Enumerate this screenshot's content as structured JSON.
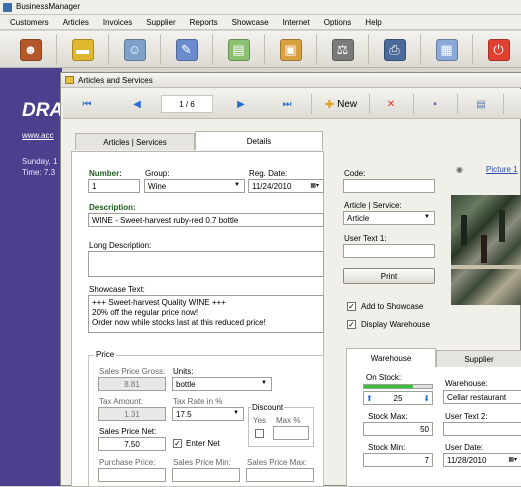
{
  "app": {
    "title": "BusinessManager"
  },
  "menu": [
    "Customers",
    "Articles",
    "Invoices",
    "Supplier",
    "Reports",
    "Showcase",
    "Internet",
    "Options",
    "Help"
  ],
  "toolbar": [
    {
      "icon": "users-icon",
      "color": "#b4572a",
      "glyph": "☻"
    },
    {
      "icon": "folder-icon",
      "color": "#e0b830",
      "glyph": "▬"
    },
    {
      "icon": "group-icon",
      "color": "#7fa0c8",
      "glyph": "☺"
    },
    {
      "icon": "pen-icon",
      "color": "#6a8ccc",
      "glyph": "✎"
    },
    {
      "icon": "chart-icon",
      "color": "#8bc070",
      "glyph": "▤"
    },
    {
      "icon": "picture-icon",
      "color": "#d8a040",
      "glyph": "▣"
    },
    {
      "icon": "scales-icon",
      "color": "#7a7a7a",
      "glyph": "⚖"
    },
    {
      "icon": "printer-icon",
      "color": "#4a6a9a",
      "glyph": "⎙"
    },
    {
      "icon": "calculator-icon",
      "color": "#8aa8d8",
      "glyph": "▦"
    },
    {
      "icon": "power-icon",
      "color": "#e04030",
      "glyph": "⏻"
    }
  ],
  "background": {
    "brand": "DRA",
    "link": "www.acc",
    "date": "Sunday, 1",
    "time": "Time: 7.3"
  },
  "window": {
    "title": "Articles and Services",
    "counter": "1 / 6",
    "new_label": "New",
    "tabs": [
      "Articles | Services",
      "Details"
    ]
  },
  "form": {
    "number_label": "Number:",
    "number": "1",
    "group_label": "Group:",
    "group": "Wine",
    "reg_date_label": "Reg. Date:",
    "reg_date": "11/24/2010",
    "code_label": "Code:",
    "code": "",
    "description_label": "Description:",
    "description": "WINE - Sweet-harvest ruby-red 0.7 bottle",
    "article_service_label": "Article | Service:",
    "article_service": "Article",
    "user_text1_label": "User Text 1:",
    "user_text1": "",
    "long_description_label": "Long Description:",
    "long_description": "",
    "print_label": "Print",
    "showcase_text_label": "Showcase Text:",
    "showcase_lines": [
      "+++ Sweet-harvest Quality WINE +++",
      "20% off the regular price now!",
      "Order now while stocks last at this reduced price!"
    ],
    "add_showcase_label": "Add to Showcase",
    "add_showcase": true,
    "display_warehouse_label": "Display Warehouse",
    "display_warehouse": true,
    "picture_link": "Picture 1"
  },
  "price": {
    "group_label": "Price",
    "gross_label": "Sales Price Gross:",
    "gross": "8.81",
    "units_label": "Units:",
    "units": "bottle",
    "tax_amount_label": "Tax Amount:",
    "tax_amount": "1.31",
    "tax_rate_label": "Tax Rate in %",
    "tax_rate": "17.5",
    "discount_label": "Discount",
    "yes_label": "Yes",
    "max_label": "Max %",
    "max": "",
    "net_label": "Sales Price Net:",
    "net": "7.50",
    "enter_net_label": "Enter Net",
    "enter_net": true,
    "purchase_label": "Purchase Price:",
    "min_label": "Sales Price Min:",
    "max_price_label": "Sales Price Max:"
  },
  "warehouse": {
    "tabs": [
      "Warehouse",
      "Supplier"
    ],
    "on_stock_label": "On Stock:",
    "on_stock": "25",
    "stock_fill": 0.72,
    "warehouse_label": "Warehouse:",
    "warehouse": "Cellar restaurant",
    "stock_max_label": "Stock Max:",
    "stock_max": "50",
    "user_text2_label": "User Text 2:",
    "user_text2": "",
    "stock_min_label": "Stock Min:",
    "stock_min": "7",
    "user_date_label": "User Date:",
    "user_date": "11/28/2010"
  }
}
